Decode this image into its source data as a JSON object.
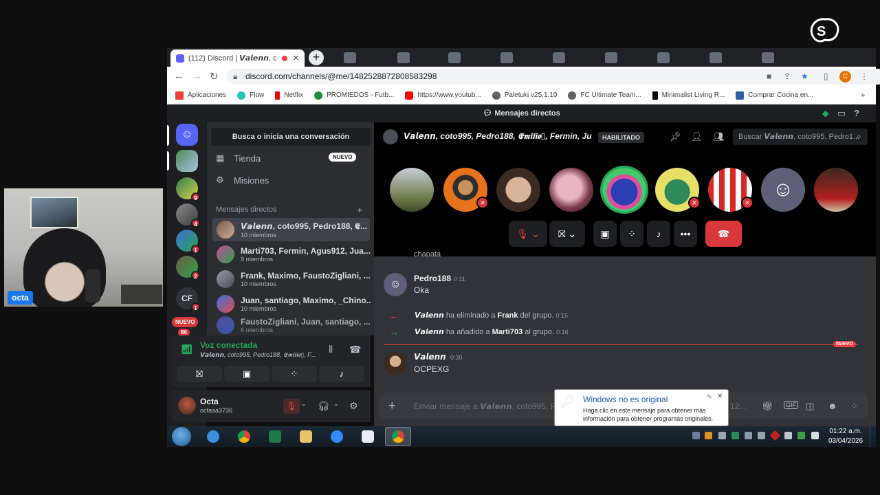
{
  "overlay": {
    "brand": "streamyard",
    "cam_name": "octa"
  },
  "browser": {
    "tab_title": "(112) Discord | 𝙑𝙖𝙡𝙚𝙣𝙣, coto",
    "url": "discord.com/channels/@me/1482528872808583298",
    "bookmarks": [
      "Aplicaciones",
      "Flow",
      "Netflix",
      "PROMIEDOS - Futb...",
      "https://www.youtub...",
      "Paletuki v25.1.10",
      "FC Ultimate Team...",
      "Minimalist Living R...",
      "Comprar Cocina en..."
    ],
    "profile_initial": "C",
    "more_bookmarks": "»"
  },
  "discord": {
    "top_title": "Mensajes directos",
    "search_placeholder": "Busca o inicia una conversación",
    "nav": [
      {
        "label": "Tienda",
        "badge": "NUEVO"
      },
      {
        "label": "Misiones"
      }
    ],
    "dm_header": "Mensajes directos",
    "dms": [
      {
        "title": "𝙑𝙖𝙡𝙚𝙣𝙣, coto995, Pedro188, 𝕰...",
        "sub": "10 miembros"
      },
      {
        "title": "Marti703, Fermin, Agus912, Jua...",
        "sub": "9 miembros"
      },
      {
        "title": "Frank, Maximo, FaustoZigliani, ...",
        "sub": "10 miembros"
      },
      {
        "title": "Juan, santiago, Maximo, _Chino...",
        "sub": "10 miembros"
      },
      {
        "title": "FaustoZigliani, Juan, santiago, ...",
        "sub": "6 miembros"
      }
    ],
    "servers": {
      "badges": [
        "9",
        "4",
        "1",
        "2",
        "1"
      ],
      "cf_label": "CF",
      "nuevo": "NUEVO",
      "bottom_badge": "86"
    },
    "voice": {
      "status": "Voz conectada",
      "channel": "𝙑𝙖𝙡𝙚𝙣𝙣, coto995, Pedro188, 𝕰𝖒𝖎𝖑𝖎𝖔▯, F..."
    },
    "user": {
      "name": "Octa",
      "tag": "octaaa3736"
    },
    "call": {
      "title": "𝙑𝙖𝙡𝙚𝙣𝙣, coto995, Pedro188, 𝕰𝖒𝖎𝖑𝖎𝖔▯, Fermin, Ju",
      "badge": "HABILITADO",
      "search": "Buscar 𝙑𝙖𝙡𝙚𝙣𝙣, coto995, Pedro1..."
    },
    "chat": {
      "cut_text": "chapata",
      "messages": [
        {
          "author": "Pedro188",
          "time": "0:11",
          "text": "Oka"
        },
        {
          "author": "𝙑𝙖𝙡𝙚𝙣𝙣",
          "time": "0:30",
          "text": "OCPEXG"
        }
      ],
      "system": [
        {
          "actor": "𝙑𝙖𝙡𝙚𝙣𝙣",
          "verb": " ha eliminado a ",
          "target": "Frank",
          "tail": " del grupo. ",
          "time": "0:15"
        },
        {
          "actor": "𝙑𝙖𝙡𝙚𝙣𝙣",
          "verb": " ha añadido a ",
          "target": "Marti703",
          "tail": " al grupo. ",
          "time": "0:16"
        }
      ],
      "new_label": "NUEVO",
      "composer_placeholder": "Enviar mensaje a 𝙑𝙖𝙡𝙚𝙣𝙣, coto995, P",
      "composer_overflow": "12..."
    }
  },
  "windows": {
    "popup_title": "Windows no es original",
    "popup_body": "Haga clic en este mensaje para obtener más información para obtener programas originales.",
    "clock_time": "01:22 a.m.",
    "clock_date": "03/04/2026"
  },
  "colors": {
    "discord_blurple": "#5865f2",
    "voice_green": "#23a55a",
    "danger_red": "#da373c"
  }
}
